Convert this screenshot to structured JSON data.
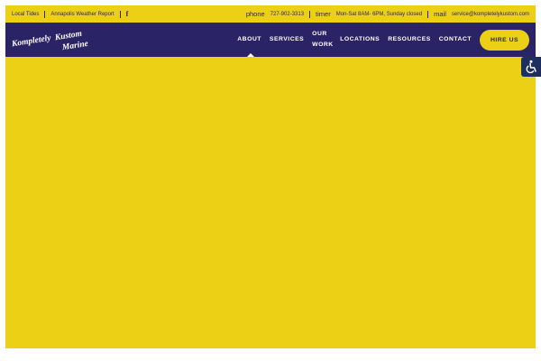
{
  "topbar": {
    "link_tides": "Local Tides",
    "link_weather": "Annapolis Weather Report",
    "facebook_glyph": "f",
    "phone_icon_label": "phone",
    "phone": "727-902-3313",
    "timer_icon_label": "timer",
    "hours": "Mon-Sat 8AM- 6PM, Sunday closed",
    "mail_icon_label": "mail",
    "email": "service@kompletelykustom.com"
  },
  "logo": {
    "line1": "Kompletely",
    "line2": "Kustom",
    "line3": "Marine"
  },
  "nav": {
    "items": [
      "ABOUT",
      "SERVICES",
      "OUR WORK",
      "LOCATIONS",
      "RESOURCES",
      "CONTACT"
    ],
    "cta": "HIRE US"
  },
  "colors": {
    "yellow": "#ecd016",
    "navy": "#2a2466",
    "accessibility_bg": "#1d2f5e"
  },
  "icons": {
    "facebook": "facebook-icon",
    "accessibility": "accessibility-icon"
  }
}
